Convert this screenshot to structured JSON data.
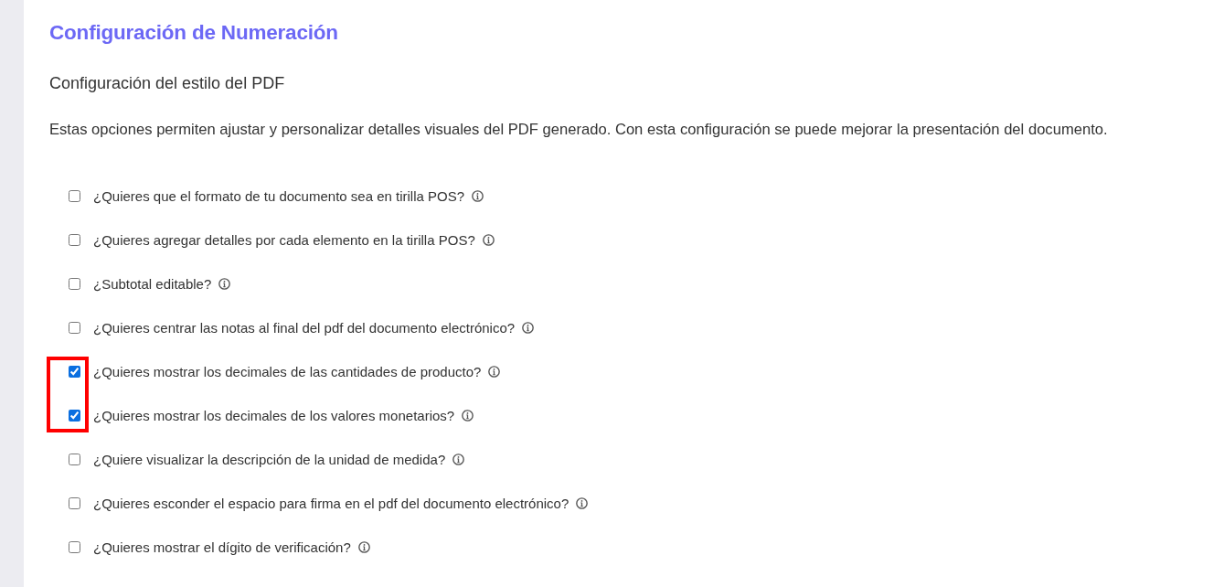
{
  "page": {
    "title": "Configuración de Numeración",
    "subtitle": "Configuración del estilo del PDF",
    "description": "Estas opciones permiten ajustar y personalizar detalles visuales del PDF generado. Con esta configuración se puede mejorar la presentación del documento."
  },
  "options": [
    {
      "label": "¿Quieres que el formato de tu documento sea en tirilla POS?",
      "checked": false,
      "highlighted": false
    },
    {
      "label": "¿Quieres agregar detalles por cada elemento en la tirilla POS?",
      "checked": false,
      "highlighted": false
    },
    {
      "label": "¿Subtotal editable?",
      "checked": false,
      "highlighted": false
    },
    {
      "label": "¿Quieres centrar las notas al final del pdf del documento electrónico?",
      "checked": false,
      "highlighted": false
    },
    {
      "label": "¿Quieres mostrar los decimales de las cantidades de producto?",
      "checked": true,
      "highlighted": true
    },
    {
      "label": "¿Quieres mostrar los decimales de los valores monetarios?",
      "checked": true,
      "highlighted": true
    },
    {
      "label": "¿Quiere visualizar la descripción de la unidad de medida?",
      "checked": false,
      "highlighted": false
    },
    {
      "label": "¿Quieres esconder el espacio para firma en el pdf del documento electrónico?",
      "checked": false,
      "highlighted": false
    },
    {
      "label": "¿Quieres mostrar el dígito de verificación?",
      "checked": false,
      "highlighted": false
    }
  ]
}
